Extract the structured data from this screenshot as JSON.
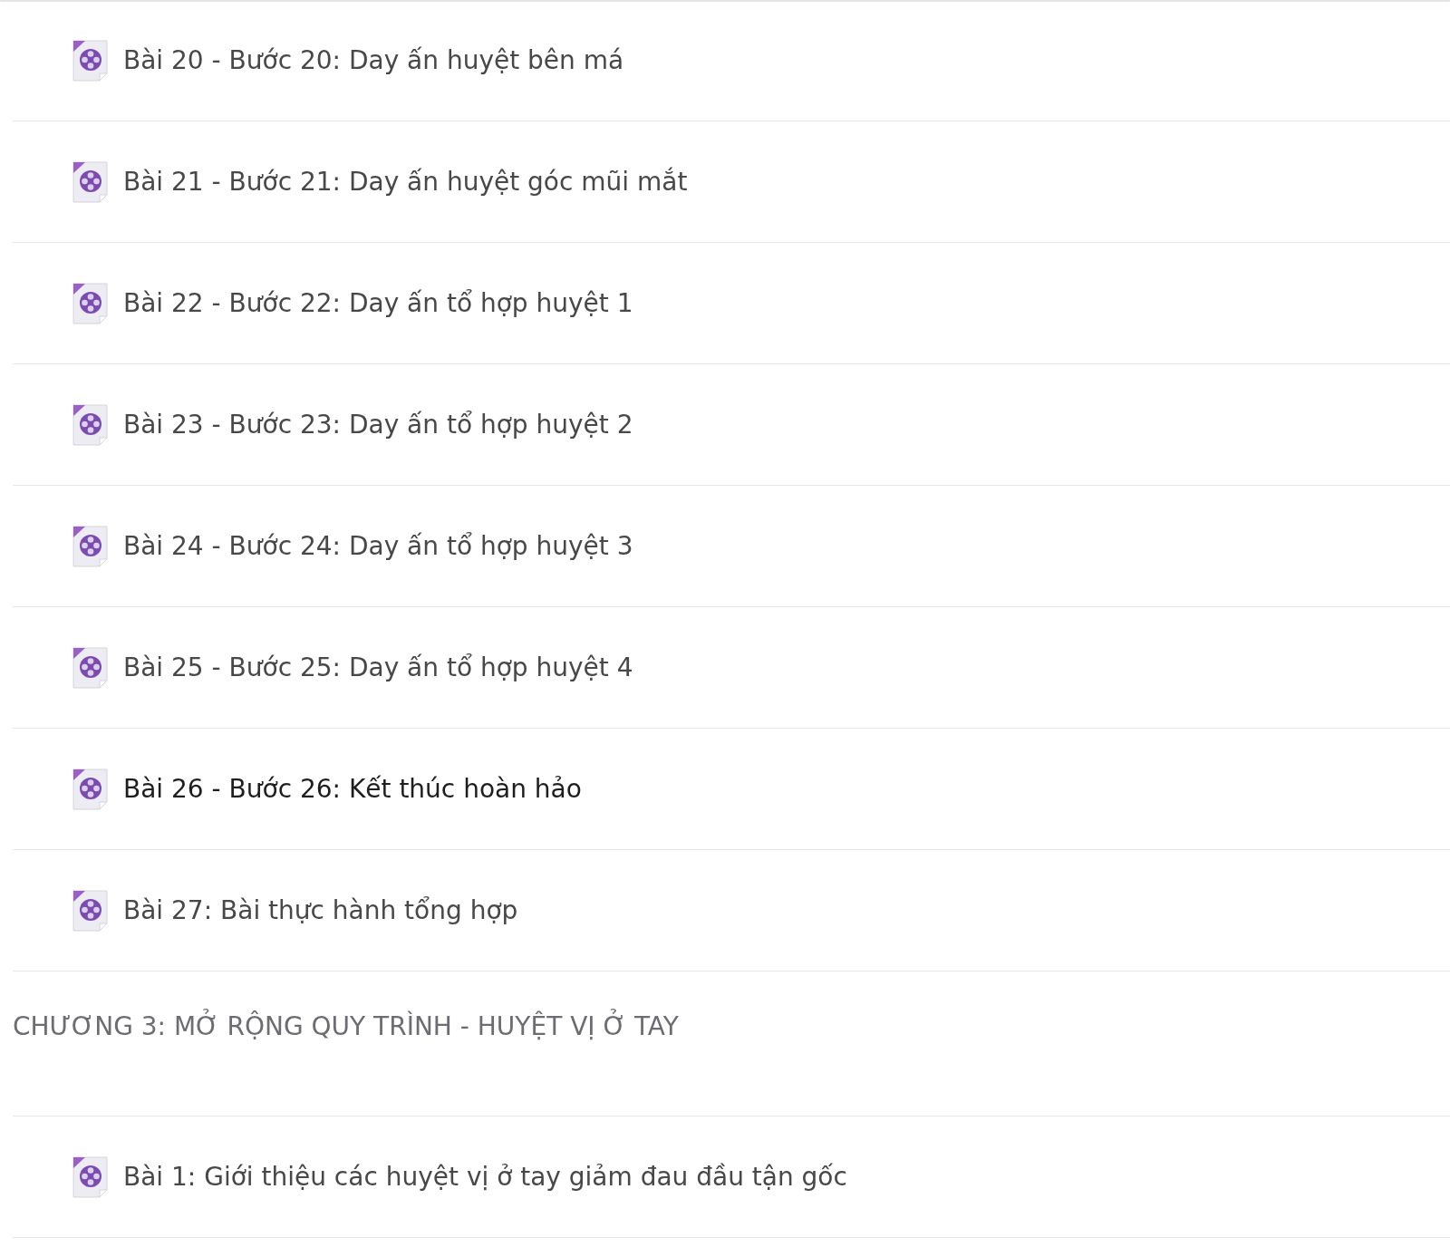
{
  "sections": [
    {
      "kind": "lessons",
      "lessons": [
        {
          "title": "Bài 20 - Bước 20: Day ấn huyệt bên má",
          "selected": false
        },
        {
          "title": "Bài 21 - Bước 21: Day ấn huyệt góc mũi mắt",
          "selected": false
        },
        {
          "title": "Bài 22 - Bước 22: Day ấn tổ hợp huyệt 1",
          "selected": false
        },
        {
          "title": "Bài 23 - Bước 23: Day ấn tổ hợp huyệt 2",
          "selected": false
        },
        {
          "title": "Bài 24 - Bước 24: Day ấn tổ hợp huyệt 3",
          "selected": false
        },
        {
          "title": "Bài 25 - Bước 25: Day ấn tổ hợp huyệt 4",
          "selected": false
        },
        {
          "title": "Bài 26 - Bước 26: Kết thúc hoàn hảo",
          "selected": true
        },
        {
          "title": "Bài 27: Bài thực hành tổng hợp",
          "selected": false
        }
      ]
    },
    {
      "kind": "chapter",
      "title": "CHƯƠNG 3: MỞ RỘNG QUY TRÌNH - HUYỆT VỊ Ở TAY",
      "lessons": [
        {
          "title": "Bài 1: Giới thiệu các huyệt vị ở tay giảm đau đầu tận gốc",
          "selected": false
        }
      ]
    }
  ]
}
